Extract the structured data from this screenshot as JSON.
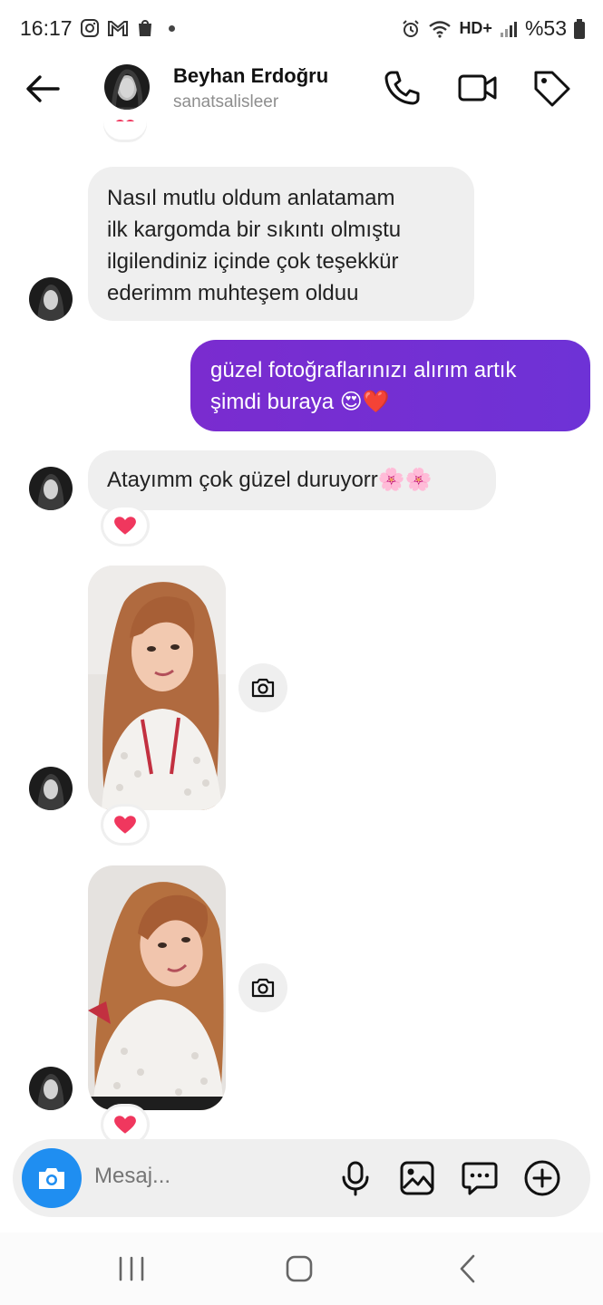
{
  "status_bar": {
    "time": "16:17",
    "battery": "%53",
    "network": "HD+"
  },
  "header": {
    "name": "Beyhan Erdoğru",
    "username": "sanatsalisleer"
  },
  "messages": {
    "m1": {
      "lines": [
        "Nasıl mutlu oldum anlatamam",
        "ilk kargomda bir sıkıntı olmıştu",
        "ilgilendiniz içinde çok teşekkür",
        "ederimm muhteşem olduu"
      ]
    },
    "m2": {
      "lines": [
        "güzel fotoğraflarınızı alırım artık",
        "şimdi buraya 😍❤️"
      ]
    },
    "m3": {
      "text": "Atayımm çok güzel duruyorr🌸🌸"
    }
  },
  "composer": {
    "placeholder": "Mesaj..."
  },
  "colors": {
    "outgoing_bubble": "#7a2ccf",
    "incoming_bubble": "#efefef",
    "camera_button": "#1f8ef1",
    "reaction_heart": "#f0375e"
  }
}
